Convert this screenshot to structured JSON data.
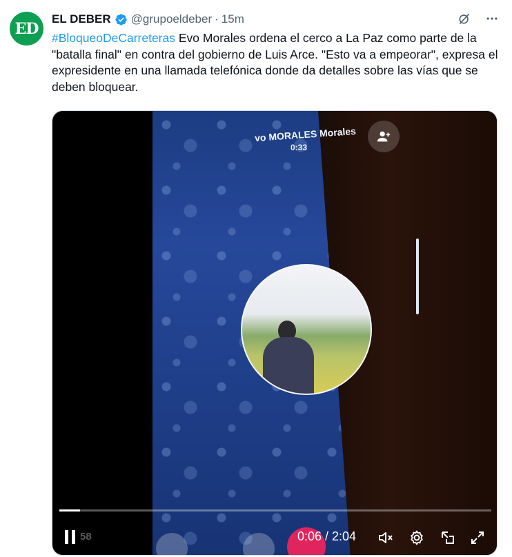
{
  "tweet": {
    "avatar_text": "ED",
    "name": "EL DEBER",
    "handle": "@grupoeldeber",
    "separator": "·",
    "time": "15m",
    "hashtag": "#BloqueoDeCarreteras",
    "body": " Evo Morales ordena el cerco a La Paz como parte de la \"batalla final\" en contra del gobierno de Luis Arce. \"Esto va a empeorar\", expresa el expresidente en una llamada telefónica donde da detalles sobre las vías que se deben bloquear."
  },
  "video": {
    "caller_name": "vo MORALES Morales",
    "call_timer": "0:33",
    "faded_time": "58",
    "current_time": "0:06",
    "duration": "2:04",
    "timecode": "0:06 / 2:04",
    "progress_fraction": 0.048
  },
  "icons": {
    "verified": "verified-badge-icon",
    "grok": "grok-icon",
    "more": "more-icon",
    "pause": "pause-icon",
    "mute": "mute-icon",
    "settings": "settings-icon",
    "pip": "picture-in-picture-icon",
    "fullscreen": "fullscreen-icon",
    "add_person": "add-person-icon"
  },
  "colors": {
    "accent": "#1d9bf0",
    "avatar_bg": "#0e9f53",
    "text_secondary": "#536471"
  }
}
